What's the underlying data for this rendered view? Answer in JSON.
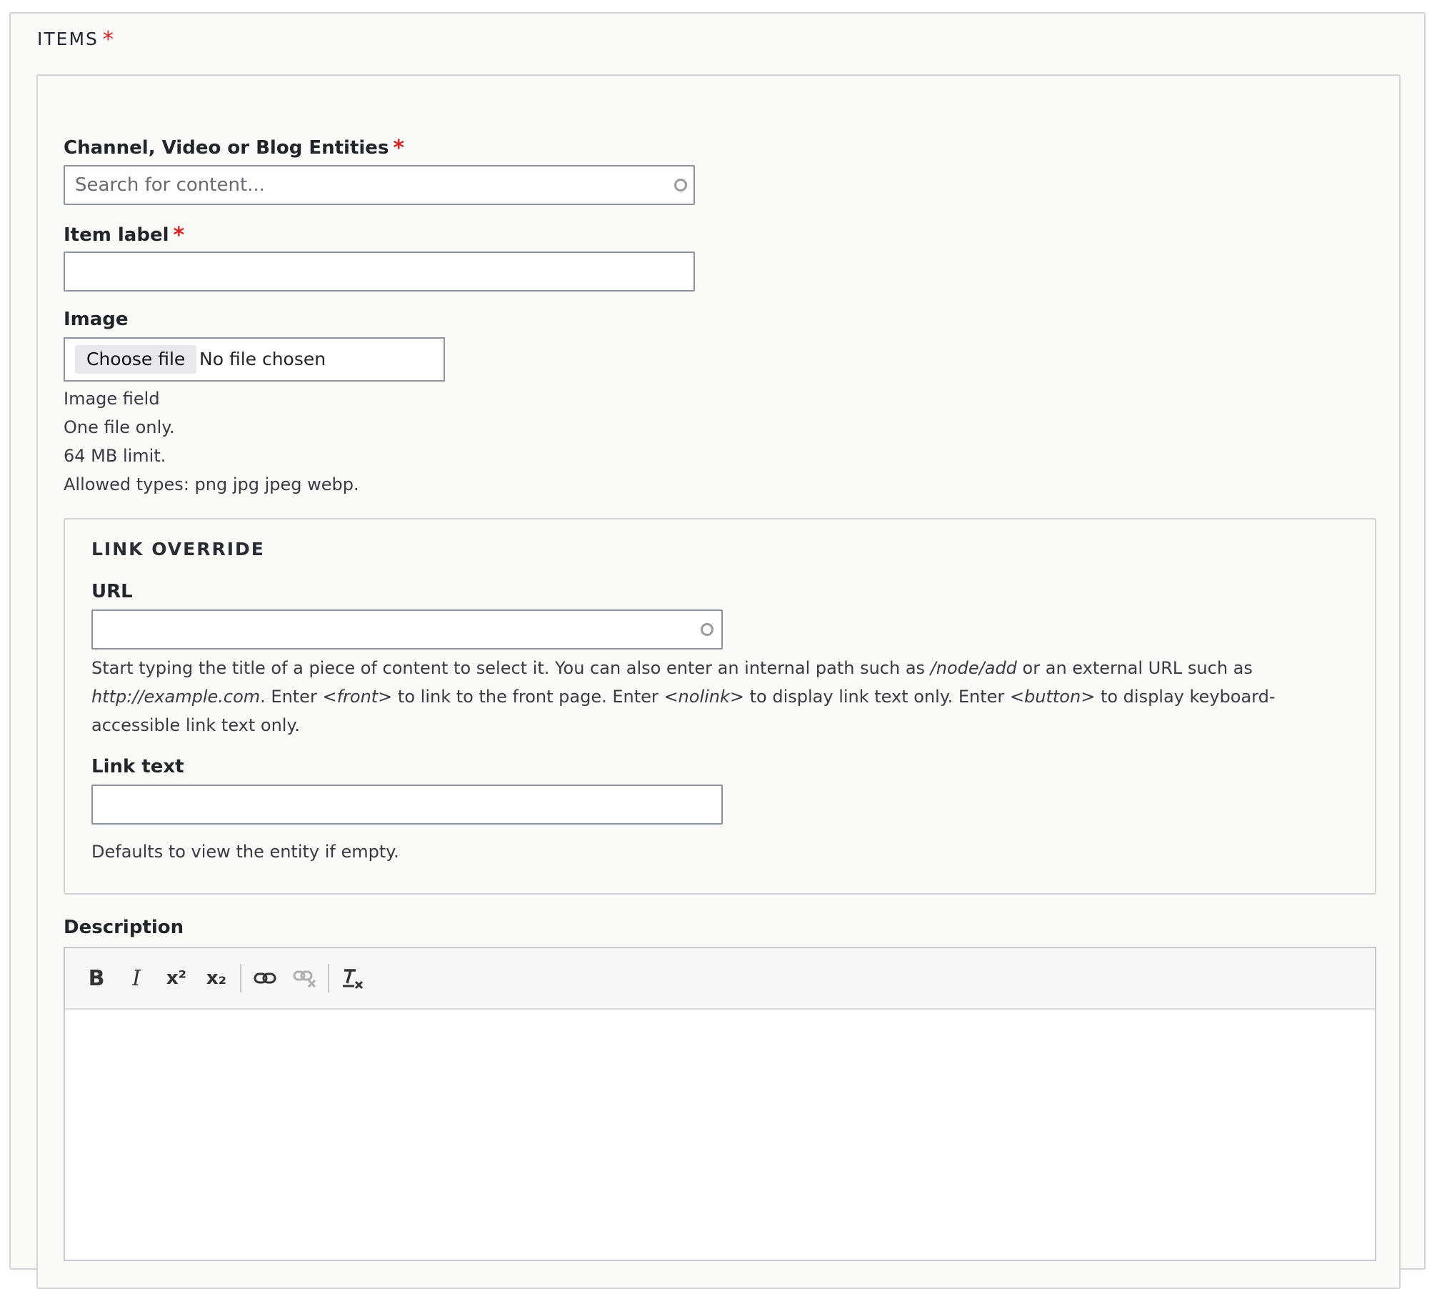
{
  "items_fieldset": {
    "legend": "ITEMS",
    "required_mark": "*"
  },
  "entities_field": {
    "label": "Channel, Video or Blog Entities",
    "required_mark": "*",
    "placeholder": "Search for content...",
    "value": ""
  },
  "item_label_field": {
    "label": "Item label",
    "required_mark": "*",
    "value": ""
  },
  "image_field": {
    "label": "Image",
    "button_label": "Choose file",
    "status": "No file chosen",
    "descriptions": [
      "Image field",
      "One file only.",
      "64 MB limit.",
      "Allowed types: png jpg jpeg webp."
    ]
  },
  "link_override": {
    "legend": "LINK OVERRIDE",
    "url_label": "URL",
    "url_value": "",
    "help_parts": [
      {
        "text": "Start typing the title of a piece of content to select it. You can also enter an internal path such as ",
        "em": false
      },
      {
        "text": "/node/add",
        "em": true
      },
      {
        "text": " or an external URL such as ",
        "em": false
      },
      {
        "text": "http://example.com",
        "em": true
      },
      {
        "text": ". Enter ",
        "em": false
      },
      {
        "text": "<front>",
        "em": true
      },
      {
        "text": " to link to the front page. Enter ",
        "em": false
      },
      {
        "text": "<nolink>",
        "em": true
      },
      {
        "text": " to display link text only. Enter ",
        "em": false
      },
      {
        "text": "<button>",
        "em": true
      },
      {
        "text": " to display keyboard-accessible link text only.",
        "em": false
      }
    ],
    "link_text_label": "Link text",
    "link_text_value": "",
    "link_text_help": "Defaults to view the entity if empty."
  },
  "description_field": {
    "label": "Description",
    "toolbar": {
      "bold": "B",
      "italic": "I",
      "superscript": "x²",
      "subscript": "x₂",
      "link": "link-icon",
      "unlink": "unlink-icon",
      "remove_format": "remove-format-icon"
    }
  }
}
